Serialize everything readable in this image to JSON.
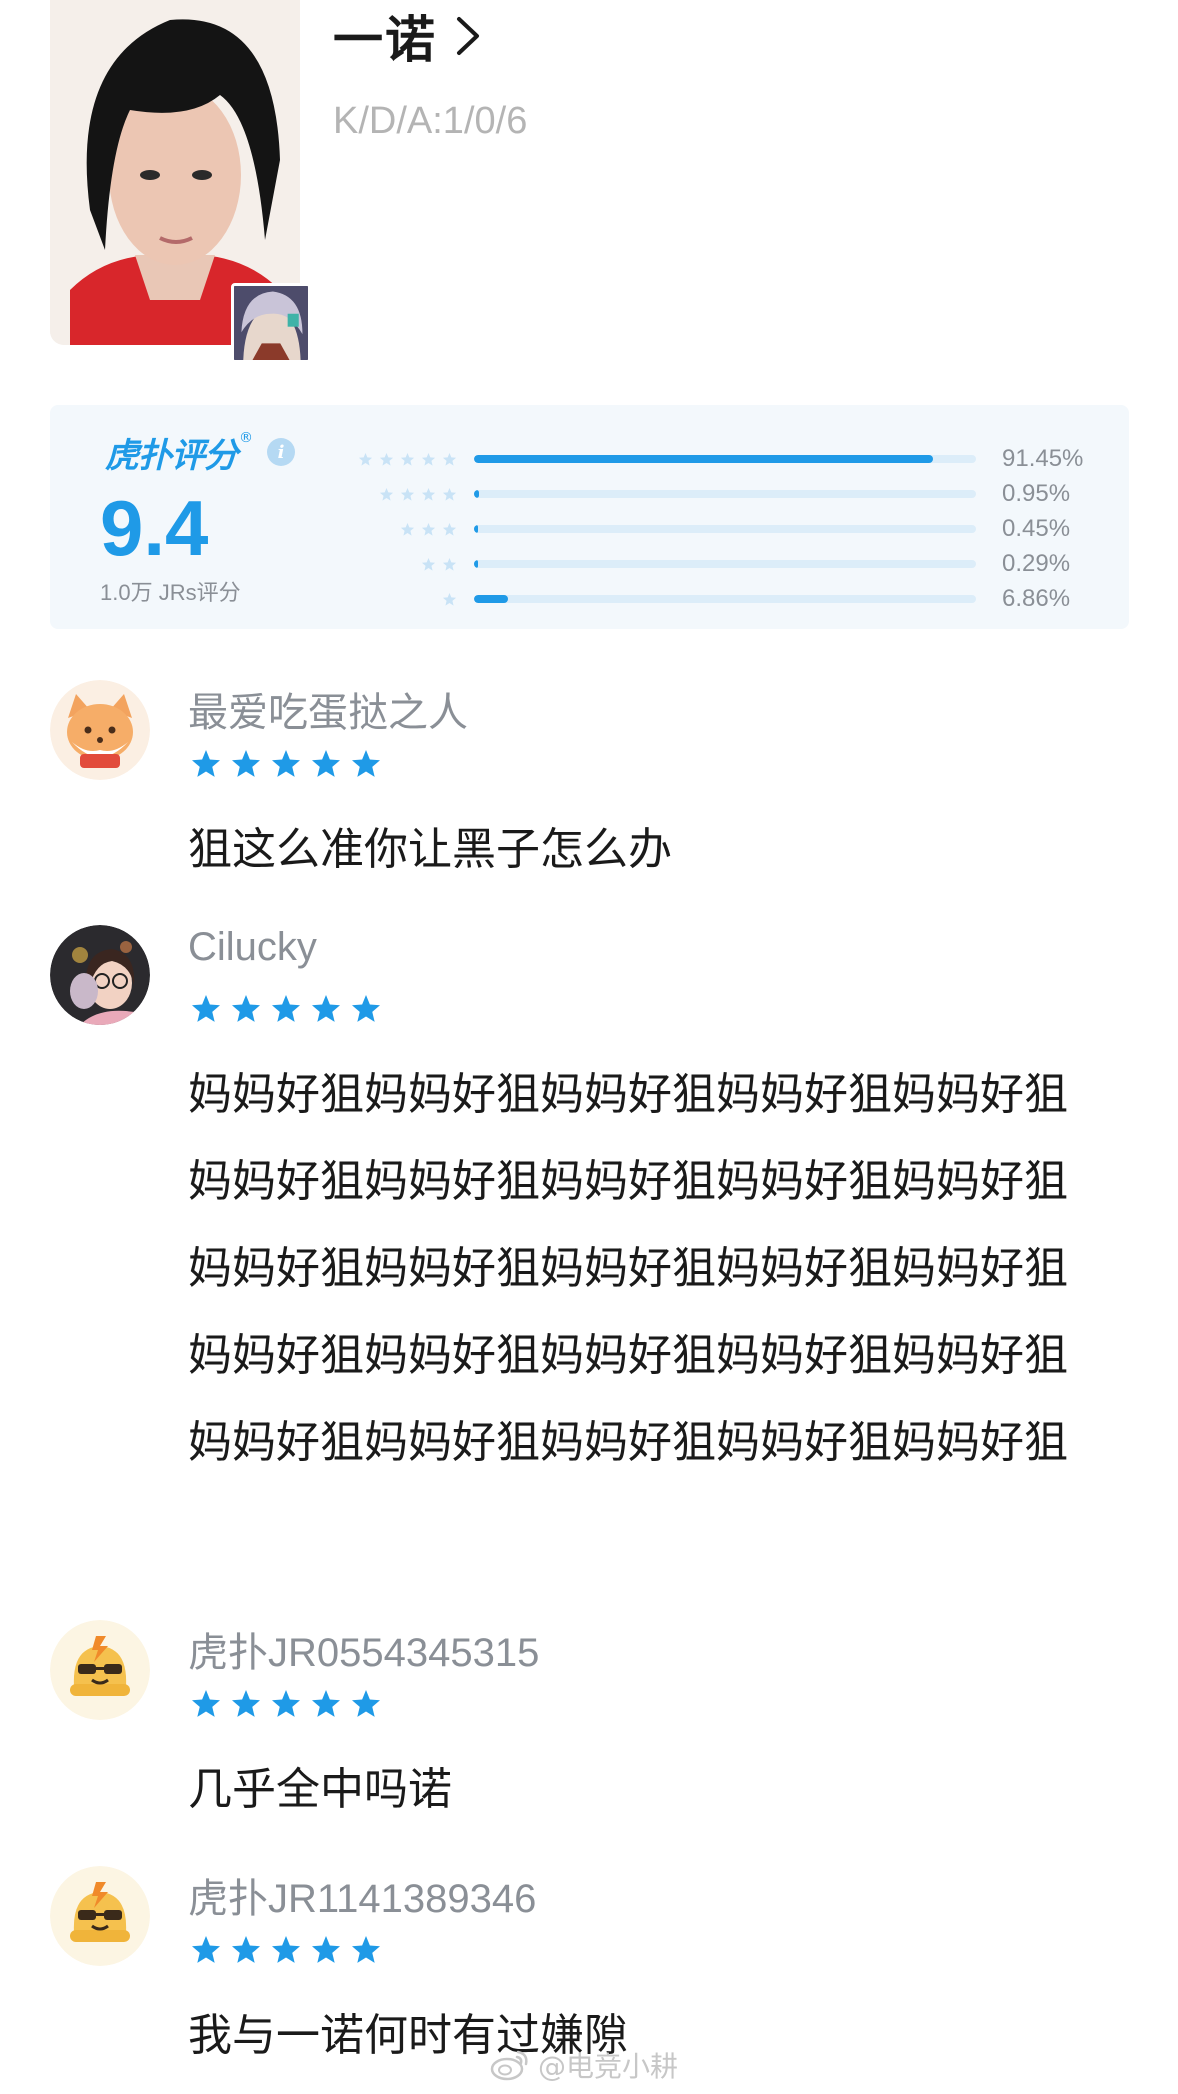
{
  "player": {
    "name": "一诺",
    "kda": "K/D/A:1/0/6",
    "photo_icon": "player-photo",
    "hero_icon": "hero-avatar"
  },
  "rating": {
    "brand": "虎扑评分",
    "brand_mark": "®",
    "info_icon": "i",
    "score": "9.4",
    "count_label": "1.0万 JRs评分",
    "accent_color": "#1f9ae7",
    "distribution": [
      {
        "stars": 5,
        "percent_label": "91.45%",
        "fraction": 0.9145
      },
      {
        "stars": 4,
        "percent_label": "0.95%",
        "fraction": 0.0095
      },
      {
        "stars": 3,
        "percent_label": "0.45%",
        "fraction": 0.0045
      },
      {
        "stars": 2,
        "percent_label": "0.29%",
        "fraction": 0.0029
      },
      {
        "stars": 1,
        "percent_label": "6.86%",
        "fraction": 0.0686
      }
    ]
  },
  "comments": [
    {
      "username": "最爱吃蛋挞之人",
      "stars": 5,
      "avatar_icon": "fox-avatar",
      "text": "狙这么准你让黑子怎么办"
    },
    {
      "username": "Cilucky",
      "stars": 5,
      "avatar_icon": "user-photo-avatar",
      "text": "妈妈好狙妈妈好狙妈妈好狙妈妈好狙妈妈好狙妈妈好狙妈妈好狙妈妈好狙妈妈好狙妈妈好狙妈妈好狙妈妈好狙妈妈好狙妈妈好狙妈妈好狙妈妈好狙妈妈好狙妈妈好狙妈妈好狙妈妈好狙妈妈好狙妈妈好狙妈妈好狙妈妈好狙妈妈好狙"
    },
    {
      "username": "虎扑JR0554345315",
      "stars": 5,
      "avatar_icon": "default-jr-avatar",
      "text": "几乎全中吗诺"
    },
    {
      "username": "虎扑JR1141389346",
      "stars": 5,
      "avatar_icon": "default-jr-avatar",
      "text": "我与一诺何时有过嫌隙"
    }
  ],
  "watermark": {
    "text": "@电竞小耕",
    "icon": "weibo-icon"
  }
}
